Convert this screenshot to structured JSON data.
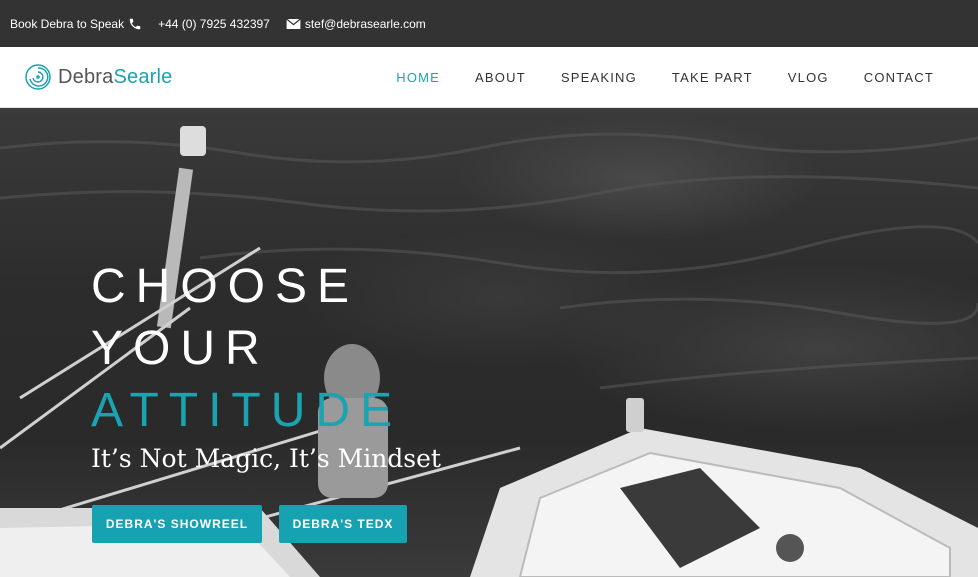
{
  "topbar": {
    "book_label": "Book Debra to Speak",
    "phone": "+44 (0) 7925 432397",
    "email": "stef@debrasearle.com"
  },
  "logo": {
    "first": "Debra",
    "last": "Searle"
  },
  "nav": {
    "items": [
      "HOME",
      "ABOUT",
      "SPEAKING",
      "TAKE PART",
      "VLOG",
      "CONTACT"
    ],
    "active": "HOME"
  },
  "hero": {
    "line1": "CHOOSE",
    "line2": "YOUR",
    "line3": "ATTITUDE",
    "tagline": "It’s Not Magic, It’s Mindset",
    "button1": "DEBRA'S SHOWREEL",
    "button2": "DEBRA'S TEDX"
  },
  "colors": {
    "accent": "#1aa3b0",
    "topbar": "#333334"
  },
  "icons": [
    "phone-icon",
    "mail-icon",
    "logo-swirl-icon"
  ]
}
